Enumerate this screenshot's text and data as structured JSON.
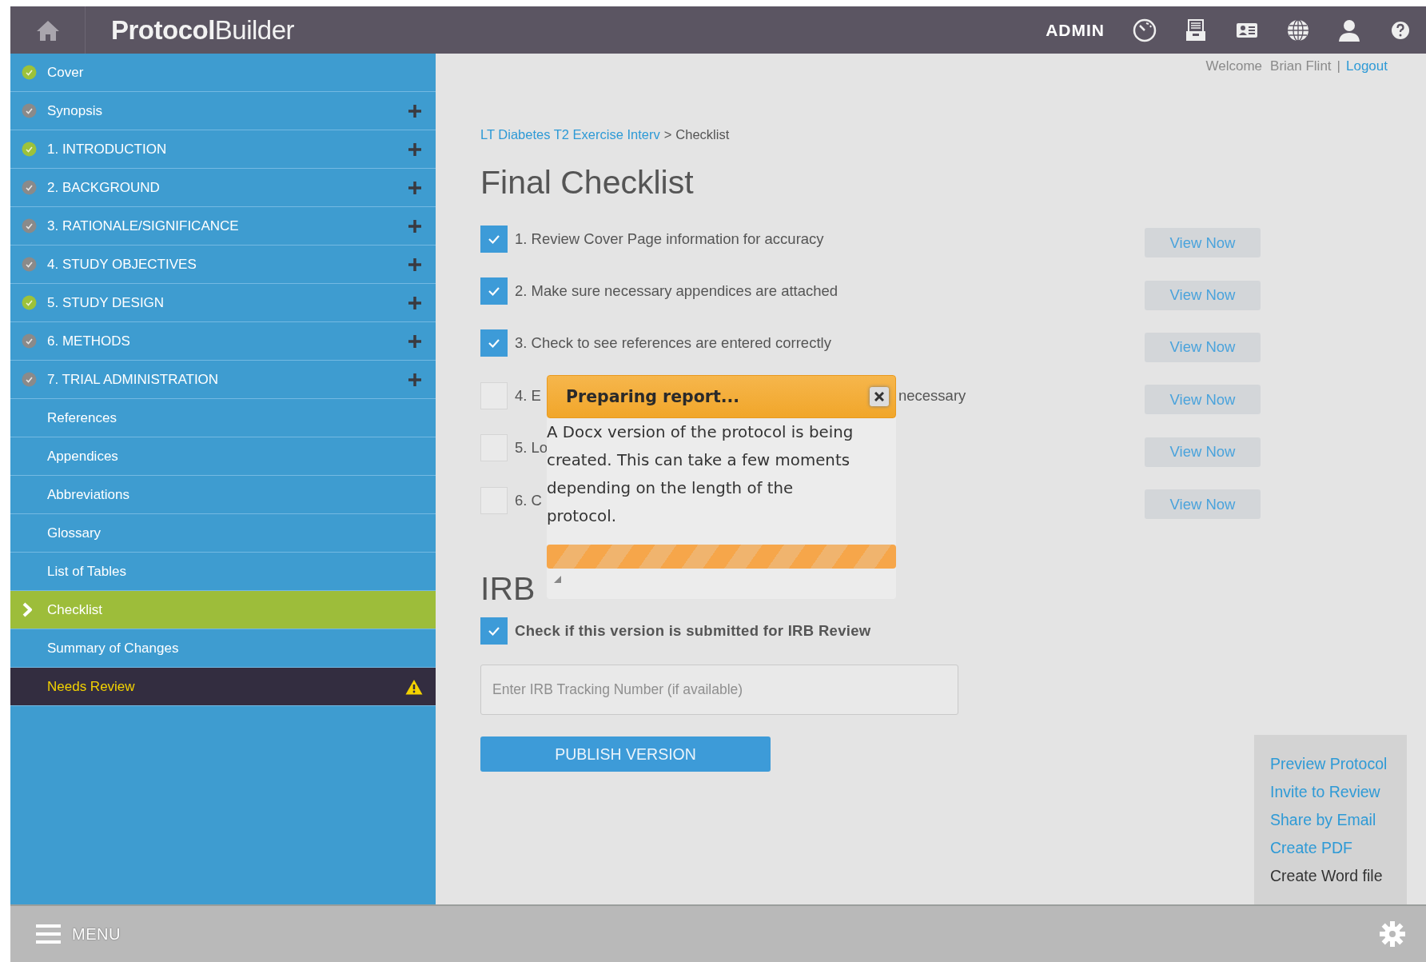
{
  "header": {
    "logo": "**Protocol**Builder",
    "role": "ADMIN"
  },
  "sidebar": {
    "items": [
      {
        "label": "Cover",
        "kind": "section",
        "complete": true,
        "expandable": false,
        "selected": false
      },
      {
        "label": "Synopsis",
        "kind": "section",
        "complete": false,
        "expandable": true,
        "selected": false
      },
      {
        "label": "1. INTRODUCTION",
        "kind": "section",
        "complete": true,
        "expandable": true,
        "selected": false
      },
      {
        "label": "2. BACKGROUND",
        "kind": "section",
        "complete": false,
        "expandable": true,
        "selected": false
      },
      {
        "label": "3. RATIONALE/SIGNIFICANCE",
        "kind": "section",
        "complete": false,
        "expandable": true,
        "selected": false
      },
      {
        "label": "4. STUDY OBJECTIVES",
        "kind": "section",
        "complete": false,
        "expandable": true,
        "selected": false
      },
      {
        "label": "5. STUDY DESIGN",
        "kind": "section",
        "complete": true,
        "expandable": true,
        "selected": false
      },
      {
        "label": "6. METHODS",
        "kind": "section",
        "complete": false,
        "expandable": true,
        "selected": false
      },
      {
        "label": "7. TRIAL ADMINISTRATION",
        "kind": "section",
        "complete": false,
        "expandable": true,
        "selected": false
      },
      {
        "label": "References",
        "kind": "page",
        "expandable": false,
        "selected": false
      },
      {
        "label": "Appendices",
        "kind": "page",
        "expandable": false,
        "selected": false
      },
      {
        "label": "Abbreviations",
        "kind": "page",
        "expandable": false,
        "selected": false
      },
      {
        "label": "Glossary",
        "kind": "page",
        "expandable": false,
        "selected": false
      },
      {
        "label": "List of Tables",
        "kind": "page",
        "expandable": false,
        "selected": false
      },
      {
        "label": "Checklist",
        "kind": "page",
        "expandable": false,
        "selected": true
      },
      {
        "label": "Summary of Changes",
        "kind": "page",
        "expandable": false,
        "selected": false
      },
      {
        "label": "Needs Review",
        "kind": "alert",
        "expandable": false,
        "selected": false
      }
    ]
  },
  "account": {
    "welcome": "Welcome",
    "user": "Brian Flint",
    "separator": "|",
    "logout": "Logout"
  },
  "breadcrumb": {
    "link": "LT Diabetes T2 Exercise Interv",
    "separator": ">",
    "current": "Checklist"
  },
  "title": "Final Checklist",
  "checklist": [
    {
      "label": "1. Review Cover Page information for accuracy",
      "checked": true,
      "button": "View Now"
    },
    {
      "label": "2. Make sure necessary appendices are attached",
      "checked": true,
      "button": "View Now"
    },
    {
      "label": "3. Check to see references are entered correctly",
      "checked": true,
      "button": "View Now"
    },
    {
      "label": "4. E",
      "label_end": "necessary",
      "checked": false,
      "button": "View Now"
    },
    {
      "label": "5. Lo",
      "checked": false,
      "button": "View Now"
    },
    {
      "label": "6. C",
      "checked": false,
      "button": "View Now"
    }
  ],
  "irb": {
    "heading": "IRB",
    "checkbox_label": "Check if this version is submitted for IRB Review",
    "checked": true,
    "placeholder": "Enter IRB Tracking Number (if available)",
    "publish": "PUBLISH VERSION"
  },
  "actions": [
    {
      "label": "Preview Protocol",
      "selected": false
    },
    {
      "label": "Invite to Review",
      "selected": false
    },
    {
      "label": "Share by Email",
      "selected": false
    },
    {
      "label": "Create PDF",
      "selected": false
    },
    {
      "label": "Create Word file",
      "selected": true
    }
  ],
  "dialog": {
    "title": "Preparing report...",
    "message": "A Docx version of the protocol is being created. This can take a few moments depending on the length of the protocol.",
    "progress": {
      "level": 1
    }
  },
  "footer": {
    "menu": "MENU"
  }
}
